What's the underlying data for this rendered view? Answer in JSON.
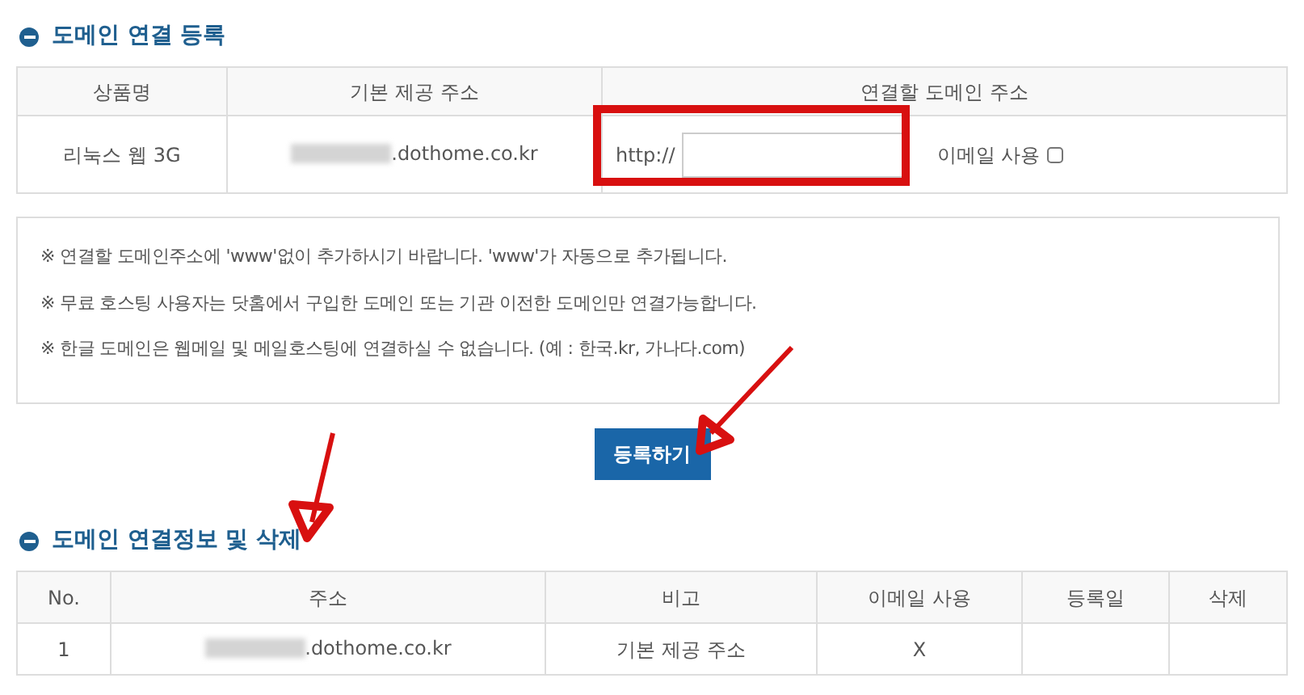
{
  "register_section": {
    "title": "도메인 연결 등록",
    "columns": [
      "상품명",
      "기본 제공 주소",
      "연결할 도메인 주소"
    ],
    "row": {
      "product": "리눅스 웹 3G",
      "default_address": ".dothome.co.kr",
      "prefix": "http://",
      "email_label": "이메일 사용",
      "email_checked": false
    }
  },
  "notices": [
    "※ 연결할 도메인주소에 'www'없이 추가하시기 바랍니다. 'www'가 자동으로 추가됩니다.",
    "※ 무료 호스팅 사용자는 닷홈에서 구입한 도메인 또는 기관 이전한 도메인만 연결가능합니다.",
    "※ 한글 도메인은 웹메일 및 메일호스팅에 연결하실 수 없습니다. (예 : 한국.kr, 가나다.com)"
  ],
  "submit_button": "등록하기",
  "list_section": {
    "title": "도메인 연결정보 및 삭제",
    "columns": [
      "No.",
      "주소",
      "비고",
      "이메일 사용",
      "등록일",
      "삭제"
    ],
    "rows": [
      {
        "no": "1",
        "address": ".dothome.co.kr",
        "note": "기본 제공 주소",
        "email": "X"
      }
    ]
  }
}
